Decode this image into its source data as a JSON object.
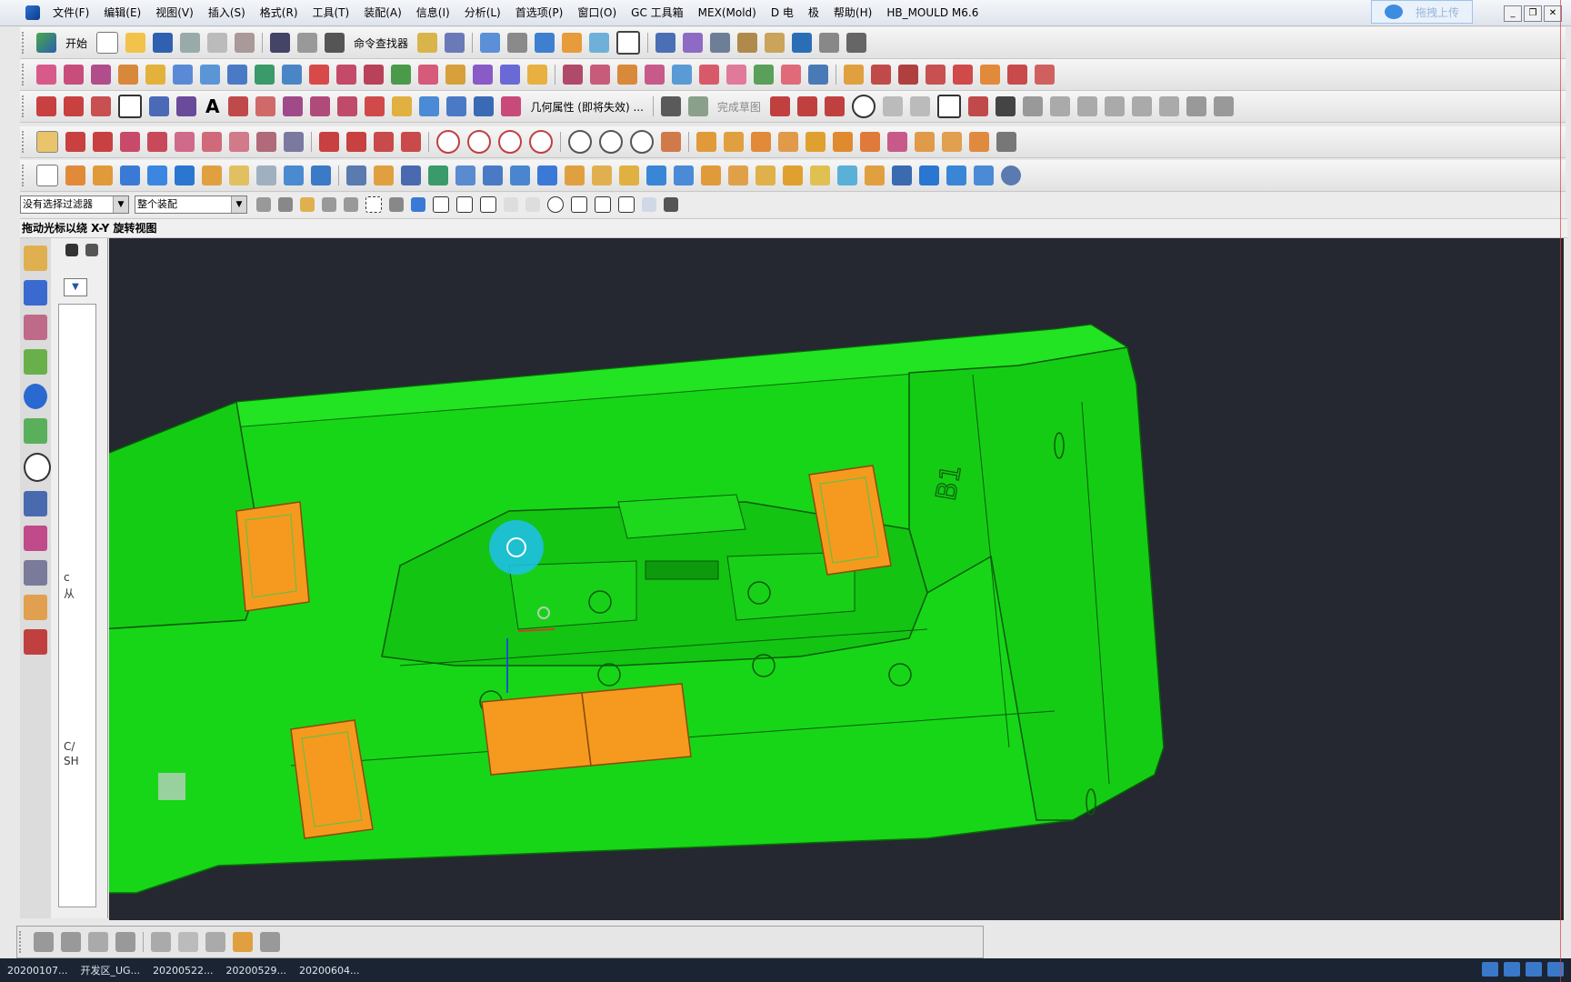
{
  "menu": {
    "items": [
      "文件(F)",
      "编辑(E)",
      "视图(V)",
      "插入(S)",
      "格式(R)",
      "工具(T)",
      "装配(A)",
      "信息(I)",
      "分析(L)",
      "首选项(P)",
      "窗口(O)",
      "GC 工具箱",
      "MEX(Mold)",
      "D 电",
      "极",
      "帮助(H)",
      "HB_MOULD M6.6"
    ]
  },
  "upload_button": "拖拽上传",
  "toolbar": {
    "start_label": "开始",
    "command_finder_label": "命令查找器",
    "geometry_props_label": "几何属性 (即将失效) ...",
    "finish_sketch_label": "完成草图"
  },
  "filter": {
    "selection_filter": "没有选择过滤器",
    "assembly_scope": "整个装配"
  },
  "hint": "拖动光标以绕 X-Y 旋转视图",
  "nav_panel": {
    "labels": [
      "c",
      "从",
      "C/",
      "SH"
    ]
  },
  "part_label": "B1",
  "taskbar": {
    "items": [
      "20200107...",
      "开发区_UG...",
      "20200522...",
      "20200529...",
      "20200604..."
    ]
  },
  "colors": {
    "plate_green": "#17d617",
    "slider_orange": "#f59a1e",
    "viewport_bg": "#252830",
    "rotate_cursor": "#1ec0f0"
  }
}
